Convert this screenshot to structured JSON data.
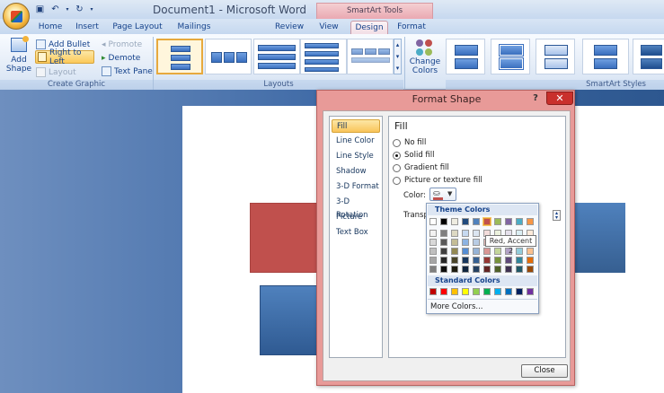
{
  "window": {
    "title": "Document1 - Microsoft Word",
    "contextual_tab_group": "SmartArt Tools"
  },
  "tabs": [
    "Home",
    "Insert",
    "Page Layout",
    "Mailings",
    "Review",
    "View",
    "Design",
    "Format"
  ],
  "active_tab": "Design",
  "ribbon": {
    "create_graphic": {
      "add_shape": [
        "Add",
        "Shape"
      ],
      "add_bullet": "Add Bullet",
      "right_to_left": "Right to Left",
      "layout": "Layout",
      "promote": "Promote",
      "demote": "Demote",
      "text_pane": "Text Pane",
      "label": "Create Graphic"
    },
    "layouts": {
      "label": "Layouts"
    },
    "change_colors": [
      "Change",
      "Colors"
    ],
    "smartart_styles": {
      "label": "SmartArt Styles"
    }
  },
  "dialog": {
    "title": "Format Shape",
    "help": "?",
    "close_x": "✕",
    "categories": [
      "Fill",
      "Line Color",
      "Line Style",
      "Shadow",
      "3-D Format",
      "3-D Rotation",
      "Picture",
      "Text Box"
    ],
    "selected_category": "Fill",
    "fill": {
      "heading": "Fill",
      "options": [
        "No fill",
        "Solid fill",
        "Gradient fill",
        "Picture or texture fill"
      ],
      "selected_option": "Solid fill",
      "color_label": "Color:",
      "transparency_label": "Transpa"
    },
    "close_button": "Close"
  },
  "color_popup": {
    "theme_header": "Theme Colors",
    "standard_header": "Standard Colors",
    "more_colors": "More Colors...",
    "tooltip": "Red, Accent 2",
    "theme_top_row": [
      "#ffffff",
      "#000000",
      "#eeece1",
      "#1f497d",
      "#4f81bd",
      "#c0504d",
      "#9bbb59",
      "#8064a2",
      "#4bacc6",
      "#f79646"
    ],
    "theme_shades": [
      [
        "#f2f2f2",
        "#7f7f7f",
        "#ddd9c3",
        "#c6d9f0",
        "#dbe5f1",
        "#f2dcdb",
        "#ebf1dd",
        "#e5e0ec",
        "#dbeef3",
        "#fdeada"
      ],
      [
        "#d8d8d8",
        "#595959",
        "#c4bd97",
        "#8db3e2",
        "#b8cce4",
        "#e5b9b7",
        "#d7e3bc",
        "#ccc1d9",
        "#b7dde8",
        "#fbd5b5"
      ],
      [
        "#bfbfbf",
        "#3f3f3f",
        "#938953",
        "#548dd4",
        "#95b3d7",
        "#d99694",
        "#c3d69b",
        "#b2a2c7",
        "#92cddc",
        "#fac08f"
      ],
      [
        "#a5a5a5",
        "#262626",
        "#494429",
        "#17365d",
        "#366092",
        "#953734",
        "#76923c",
        "#5f497a",
        "#31859b",
        "#e36c09"
      ],
      [
        "#7f7f7f",
        "#0c0c0c",
        "#1d1b10",
        "#0f243e",
        "#244061",
        "#632423",
        "#4f6128",
        "#3f3151",
        "#205867",
        "#974806"
      ]
    ],
    "standard_colors": [
      "#c00000",
      "#ff0000",
      "#ffc000",
      "#ffff00",
      "#92d050",
      "#00b050",
      "#00b0f0",
      "#0070c0",
      "#002060",
      "#7030a0"
    ]
  }
}
